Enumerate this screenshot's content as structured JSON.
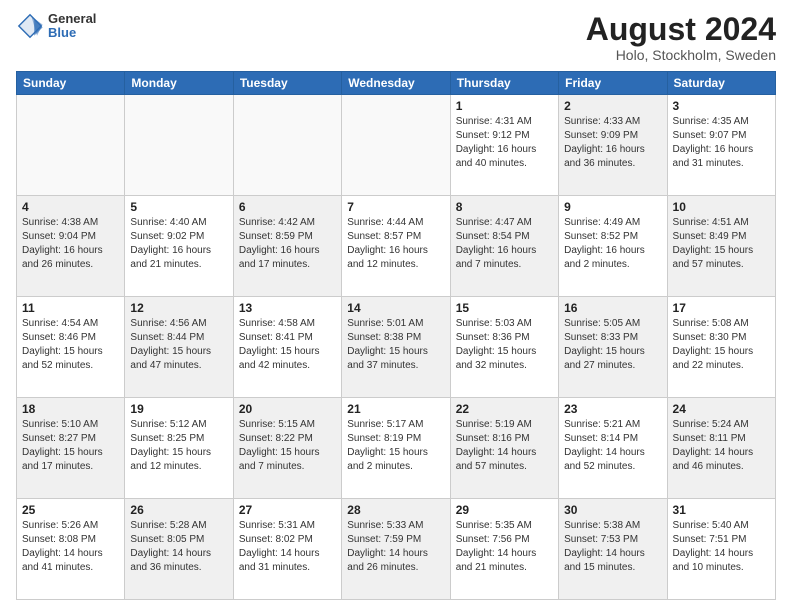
{
  "logo": {
    "general": "General",
    "blue": "Blue"
  },
  "title": "August 2024",
  "location": "Holo, Stockholm, Sweden",
  "days_of_week": [
    "Sunday",
    "Monday",
    "Tuesday",
    "Wednesday",
    "Thursday",
    "Friday",
    "Saturday"
  ],
  "weeks": [
    [
      {
        "day": "",
        "detail": "",
        "empty": true
      },
      {
        "day": "",
        "detail": "",
        "empty": true
      },
      {
        "day": "",
        "detail": "",
        "empty": true
      },
      {
        "day": "",
        "detail": "",
        "empty": true
      },
      {
        "day": "1",
        "detail": "Sunrise: 4:31 AM\nSunset: 9:12 PM\nDaylight: 16 hours\nand 40 minutes."
      },
      {
        "day": "2",
        "detail": "Sunrise: 4:33 AM\nSunset: 9:09 PM\nDaylight: 16 hours\nand 36 minutes.",
        "shaded": true
      },
      {
        "day": "3",
        "detail": "Sunrise: 4:35 AM\nSunset: 9:07 PM\nDaylight: 16 hours\nand 31 minutes."
      }
    ],
    [
      {
        "day": "4",
        "detail": "Sunrise: 4:38 AM\nSunset: 9:04 PM\nDaylight: 16 hours\nand 26 minutes.",
        "shaded": true
      },
      {
        "day": "5",
        "detail": "Sunrise: 4:40 AM\nSunset: 9:02 PM\nDaylight: 16 hours\nand 21 minutes."
      },
      {
        "day": "6",
        "detail": "Sunrise: 4:42 AM\nSunset: 8:59 PM\nDaylight: 16 hours\nand 17 minutes.",
        "shaded": true
      },
      {
        "day": "7",
        "detail": "Sunrise: 4:44 AM\nSunset: 8:57 PM\nDaylight: 16 hours\nand 12 minutes."
      },
      {
        "day": "8",
        "detail": "Sunrise: 4:47 AM\nSunset: 8:54 PM\nDaylight: 16 hours\nand 7 minutes.",
        "shaded": true
      },
      {
        "day": "9",
        "detail": "Sunrise: 4:49 AM\nSunset: 8:52 PM\nDaylight: 16 hours\nand 2 minutes."
      },
      {
        "day": "10",
        "detail": "Sunrise: 4:51 AM\nSunset: 8:49 PM\nDaylight: 15 hours\nand 57 minutes.",
        "shaded": true
      }
    ],
    [
      {
        "day": "11",
        "detail": "Sunrise: 4:54 AM\nSunset: 8:46 PM\nDaylight: 15 hours\nand 52 minutes."
      },
      {
        "day": "12",
        "detail": "Sunrise: 4:56 AM\nSunset: 8:44 PM\nDaylight: 15 hours\nand 47 minutes.",
        "shaded": true
      },
      {
        "day": "13",
        "detail": "Sunrise: 4:58 AM\nSunset: 8:41 PM\nDaylight: 15 hours\nand 42 minutes."
      },
      {
        "day": "14",
        "detail": "Sunrise: 5:01 AM\nSunset: 8:38 PM\nDaylight: 15 hours\nand 37 minutes.",
        "shaded": true
      },
      {
        "day": "15",
        "detail": "Sunrise: 5:03 AM\nSunset: 8:36 PM\nDaylight: 15 hours\nand 32 minutes."
      },
      {
        "day": "16",
        "detail": "Sunrise: 5:05 AM\nSunset: 8:33 PM\nDaylight: 15 hours\nand 27 minutes.",
        "shaded": true
      },
      {
        "day": "17",
        "detail": "Sunrise: 5:08 AM\nSunset: 8:30 PM\nDaylight: 15 hours\nand 22 minutes."
      }
    ],
    [
      {
        "day": "18",
        "detail": "Sunrise: 5:10 AM\nSunset: 8:27 PM\nDaylight: 15 hours\nand 17 minutes.",
        "shaded": true
      },
      {
        "day": "19",
        "detail": "Sunrise: 5:12 AM\nSunset: 8:25 PM\nDaylight: 15 hours\nand 12 minutes."
      },
      {
        "day": "20",
        "detail": "Sunrise: 5:15 AM\nSunset: 8:22 PM\nDaylight: 15 hours\nand 7 minutes.",
        "shaded": true
      },
      {
        "day": "21",
        "detail": "Sunrise: 5:17 AM\nSunset: 8:19 PM\nDaylight: 15 hours\nand 2 minutes."
      },
      {
        "day": "22",
        "detail": "Sunrise: 5:19 AM\nSunset: 8:16 PM\nDaylight: 14 hours\nand 57 minutes.",
        "shaded": true
      },
      {
        "day": "23",
        "detail": "Sunrise: 5:21 AM\nSunset: 8:14 PM\nDaylight: 14 hours\nand 52 minutes."
      },
      {
        "day": "24",
        "detail": "Sunrise: 5:24 AM\nSunset: 8:11 PM\nDaylight: 14 hours\nand 46 minutes.",
        "shaded": true
      }
    ],
    [
      {
        "day": "25",
        "detail": "Sunrise: 5:26 AM\nSunset: 8:08 PM\nDaylight: 14 hours\nand 41 minutes."
      },
      {
        "day": "26",
        "detail": "Sunrise: 5:28 AM\nSunset: 8:05 PM\nDaylight: 14 hours\nand 36 minutes.",
        "shaded": true
      },
      {
        "day": "27",
        "detail": "Sunrise: 5:31 AM\nSunset: 8:02 PM\nDaylight: 14 hours\nand 31 minutes."
      },
      {
        "day": "28",
        "detail": "Sunrise: 5:33 AM\nSunset: 7:59 PM\nDaylight: 14 hours\nand 26 minutes.",
        "shaded": true
      },
      {
        "day": "29",
        "detail": "Sunrise: 5:35 AM\nSunset: 7:56 PM\nDaylight: 14 hours\nand 21 minutes."
      },
      {
        "day": "30",
        "detail": "Sunrise: 5:38 AM\nSunset: 7:53 PM\nDaylight: 14 hours\nand 15 minutes.",
        "shaded": true
      },
      {
        "day": "31",
        "detail": "Sunrise: 5:40 AM\nSunset: 7:51 PM\nDaylight: 14 hours\nand 10 minutes."
      }
    ]
  ]
}
